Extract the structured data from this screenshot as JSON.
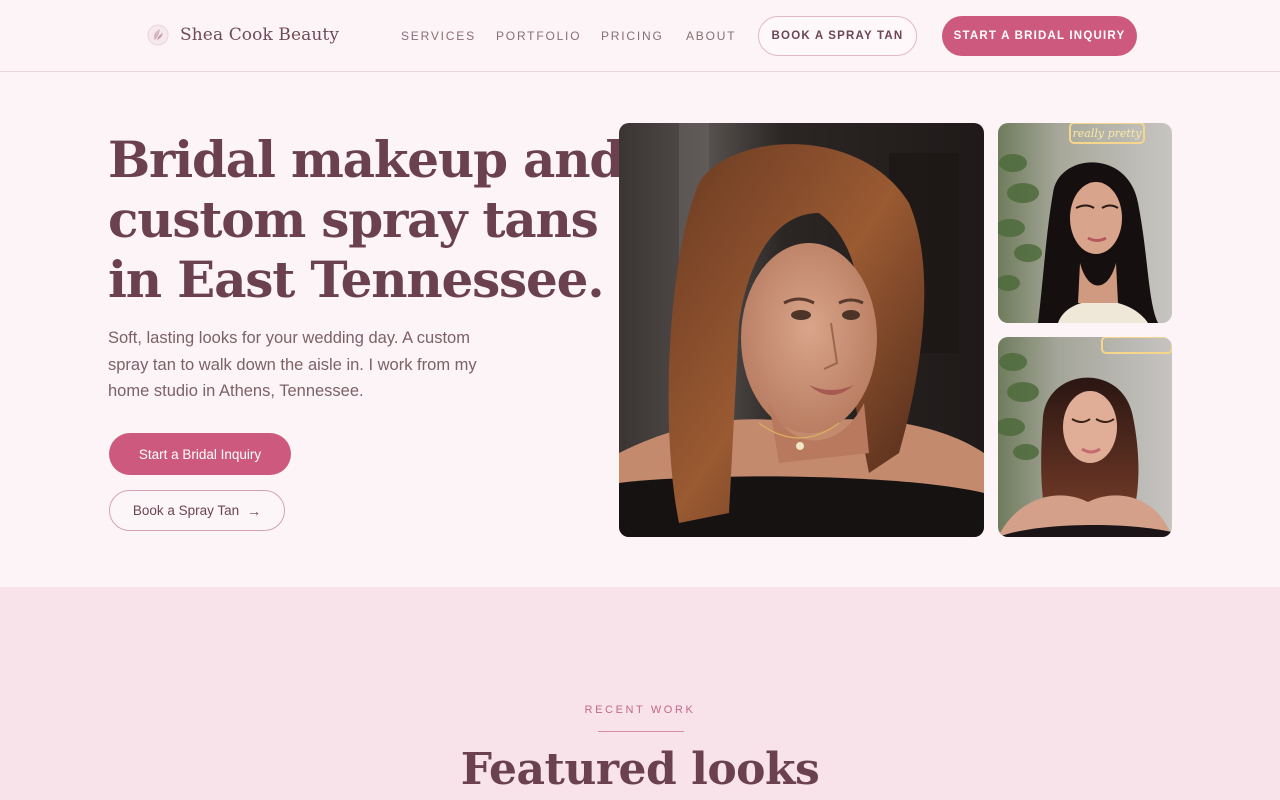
{
  "brand": {
    "name": "Shea Cook Beauty",
    "logo_icon": "flower-icon"
  },
  "nav": {
    "links": [
      "SERVICES",
      "PORTFOLIO",
      "PRICING",
      "ABOUT"
    ],
    "cta_outline": "BOOK A SPRAY TAN",
    "cta_solid": "START A BRIDAL INQUIRY"
  },
  "hero": {
    "title_lines": [
      "Bridal makeup and",
      "custom spray tans",
      "in East Tennessee."
    ],
    "subtitle": "Soft, lasting looks for your wedding day. A custom spray tan to walk down the aisle in. I work from my home studio in Athens, Tennessee.",
    "primary_button": "Start a Bridal Inquiry",
    "secondary_button": "Book a Spray Tan",
    "secondary_arrow": "→",
    "neon_sign": "really pretty"
  },
  "recent_work": {
    "eyebrow": "RECENT WORK",
    "title": "Featured looks"
  },
  "colors": {
    "accent": "#cd5a7e",
    "heading": "#6b4150",
    "background": "#fcf4f6",
    "section_background": "#f7e3e9"
  }
}
